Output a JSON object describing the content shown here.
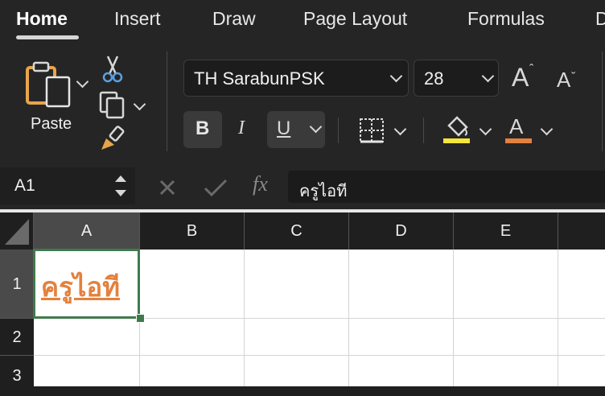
{
  "tabs": [
    "Home",
    "Insert",
    "Draw",
    "Page Layout",
    "Formulas",
    "D"
  ],
  "ribbon": {
    "paste_label": "Paste",
    "font_name": "TH SarabunPSK",
    "font_size": "28",
    "bold_label": "B",
    "italic_label": "I",
    "underline_label": "U",
    "font_color_letter": "A",
    "grow_label": "A",
    "shrink_label": "A",
    "fill_color": "#f5e63a",
    "font_color": "#e3813e"
  },
  "formula_bar": {
    "name_box": "A1",
    "fx_label": "fx",
    "content": "ครูไอที"
  },
  "sheet": {
    "columns": [
      "A",
      "B",
      "C",
      "D",
      "E"
    ],
    "rows": [
      "1",
      "2",
      "3"
    ],
    "cell_a1": "ครูไอที",
    "cell_a1_color": "#e3813e",
    "selection_color": "#3f7a4d"
  }
}
